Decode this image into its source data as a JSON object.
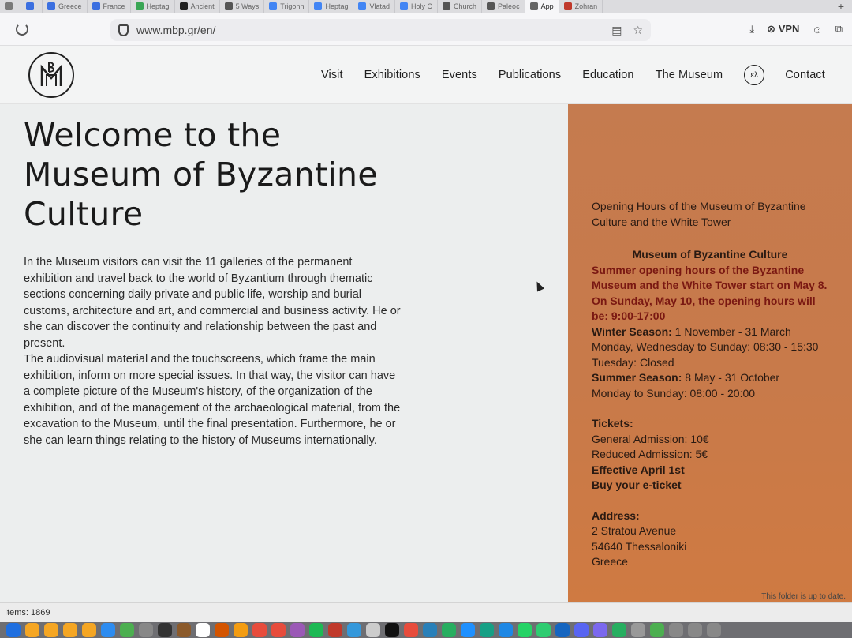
{
  "browser": {
    "tabs": [
      {
        "label": "",
        "color": "#7a7a7a"
      },
      {
        "label": "",
        "color": "#3b6fe0"
      },
      {
        "label": "Greece",
        "color": "#3b6fe0"
      },
      {
        "label": "France",
        "color": "#3b6fe0"
      },
      {
        "label": "Heptag",
        "color": "#3aa655"
      },
      {
        "label": "Ancient",
        "color": "#222222"
      },
      {
        "label": "5 Ways",
        "color": "#555555"
      },
      {
        "label": "Trigonn",
        "color": "#4285f4"
      },
      {
        "label": "Heptag",
        "color": "#4285f4"
      },
      {
        "label": "Vlatad",
        "color": "#4285f4"
      },
      {
        "label": "Holy C",
        "color": "#4285f4"
      },
      {
        "label": "Church",
        "color": "#555555"
      },
      {
        "label": "Paleoc",
        "color": "#555555"
      },
      {
        "label": "App",
        "color": "#666666",
        "active": true
      },
      {
        "label": "Zohran",
        "color": "#c0392b"
      }
    ],
    "new_tab_label": "+",
    "url": "www.mbp.gr/en/",
    "vpn_label": "VPN"
  },
  "site": {
    "nav": [
      "Visit",
      "Exhibitions",
      "Events",
      "Publications",
      "Education",
      "The Museum"
    ],
    "lang_label": "ελ",
    "contact_label": "Contact",
    "title": "Welcome to the Museum of Byzantine Culture",
    "body": "In the Museum visitors can visit the 11 galleries of the permanent exhibition and travel back to the world of Byzantium through thematic sections concerning daily private and public life, worship and burial customs, architecture and art, and commercial and business activity. He or she can discover the continuity and relationship between the past and present.\nThe audiovisual material and the touchscreens, which frame the main exhibition, inform on more special issues. In that way, the visitor can have a complete picture of the Museum's history, of the organization of the exhibition, and of the management of the archaeological material, from the excavation to the Museum, until the final presentation. Furthermore, he or she can learn things relating to the history of Museums internationally.",
    "hours_heading": "Opening Hours of the Museum of Byzantine Culture and the White Tower",
    "museum_heading": "Museum of Byzantine Culture",
    "summer_notice": "Summer opening hours of the Byzantine Museum and the White Tower start on May 8. On Sunday, May 10, the opening hours will be: 9:00-17:00",
    "winter_label": "Winter Season:",
    "winter_dates": " 1 November - 31 March",
    "winter_hours": "Monday, Wednesday to Sunday: 08:30 - 15:30",
    "tuesday": "Tuesday: Closed",
    "summer_label": "Summer Season:",
    "summer_dates": " 8 May - 31 October",
    "summer_hours": "Monday to Sunday: 08:00 - 20:00",
    "tickets_label": "Tickets:",
    "general_admission": "General Admission: 10€",
    "reduced_admission": "Reduced Admission: 5€",
    "effective": "Effective April 1st",
    "eticket": "Buy your e-ticket",
    "address_label": "Address:",
    "address_lines": [
      "2 Stratou Avenue",
      "54640 Thessaloniki",
      "Greece"
    ]
  },
  "finder": {
    "items": "Items: 1869",
    "status": "This folder is up to date."
  },
  "dock_colors": [
    "#1f6fe0",
    "#f5a623",
    "#f5a623",
    "#f5a623",
    "#f5a623",
    "#2d8cf0",
    "#4caf50",
    "#888888",
    "#333333",
    "#8b5a2b",
    "#ffffff",
    "#d35400",
    "#f39c12",
    "#e74c3c",
    "#e74c3c",
    "#9b59b6",
    "#1db954",
    "#c0392b",
    "#3498db",
    "#cccccc",
    "#111111",
    "#e74c3c",
    "#2980b9",
    "#27ae60",
    "#1e90ff",
    "#16a085",
    "#1e88e5",
    "#25d366",
    "#2ecc71",
    "#1565c0",
    "#5865f2",
    "#7b68ee",
    "#27ae60",
    "#999999",
    "#4caf50",
    "#888888",
    "#888888",
    "#888888"
  ]
}
